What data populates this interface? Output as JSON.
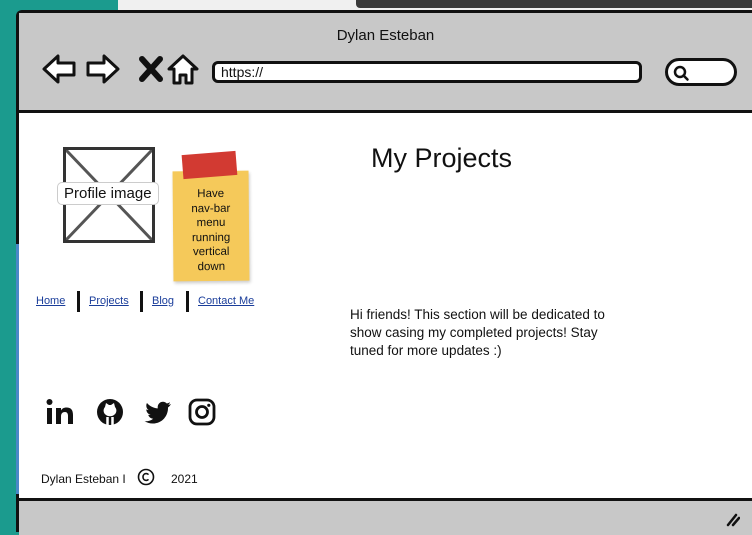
{
  "window": {
    "title": "Dylan Esteban"
  },
  "browser": {
    "url": "https://",
    "buttons": [
      "back-icon",
      "forward-icon",
      "close-icon",
      "home-icon",
      "search-icon"
    ]
  },
  "profile": {
    "label": "Profile image"
  },
  "sticky_note": {
    "lines": [
      "Have",
      "nav-bar",
      "menu",
      "running",
      "vertical",
      "down"
    ],
    "color": "#f5c95a",
    "tape_color": "#d23a32"
  },
  "nav": {
    "items": [
      "Home",
      "Projects",
      "Blog",
      "Contact Me"
    ]
  },
  "main": {
    "heading": "My Projects",
    "text": "Hi friends! This section will be dedicated to show casing my completed projects! Stay tuned for more updates :)"
  },
  "social": {
    "icons": [
      "linkedin-icon",
      "github-icon",
      "twitter-icon",
      "instagram-icon"
    ]
  },
  "footer": {
    "name": "Dylan Esteban I",
    "symbol": "copyright-icon",
    "year": "2021"
  },
  "colors": {
    "background": "#1b9b8e",
    "chrome": "#c8c8c8",
    "link": "#1a3d9a"
  }
}
